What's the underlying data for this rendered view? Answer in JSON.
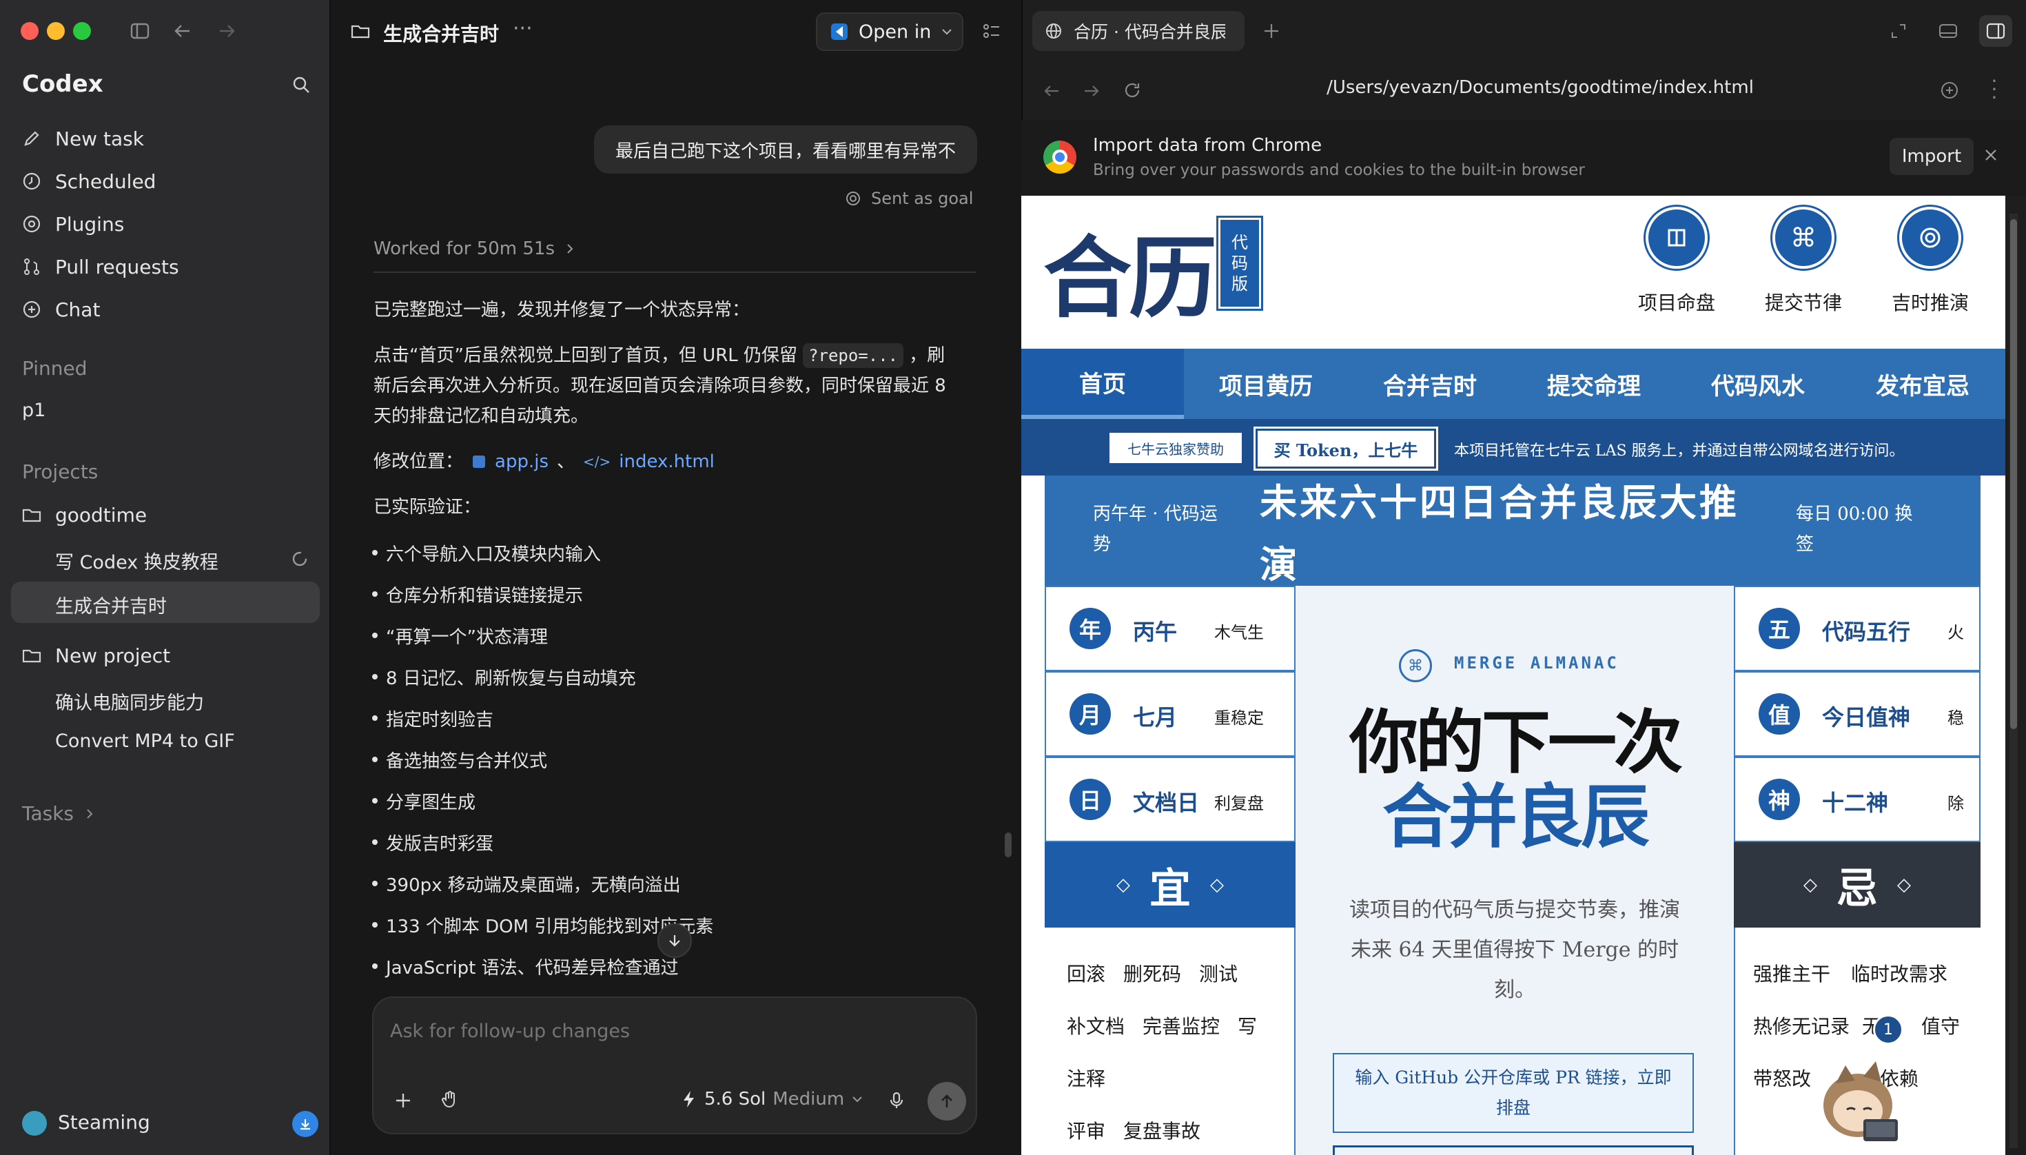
{
  "sidebar": {
    "app_name": "Codex",
    "nav": [
      {
        "label": "New task",
        "icon": "edit-icon"
      },
      {
        "label": "Scheduled",
        "icon": "clock-icon"
      },
      {
        "label": "Plugins",
        "icon": "plugin-icon"
      },
      {
        "label": "Pull requests",
        "icon": "pull-request-icon"
      },
      {
        "label": "Chat",
        "icon": "chat-plus-icon"
      }
    ],
    "pinned_header": "Pinned",
    "pinned_item": "p1",
    "projects_header": "Projects",
    "projects": [
      {
        "name": "goodtime",
        "tasks": [
          "写 Codex 换皮教程",
          "生成合并吉时"
        ]
      },
      {
        "name": "New project",
        "tasks": [
          "确认电脑同步能力",
          "Convert MP4 to GIF"
        ]
      }
    ],
    "tasks_header": "Tasks",
    "user_name": "Steaming"
  },
  "chat": {
    "title": "生成合并吉时",
    "open_in_label": "Open in",
    "user_message": "最后自己跑下这个项目，看看哪里有异常不",
    "sent_as_goal": "Sent as goal",
    "worked_for": "Worked for 50m 51s",
    "para1": "已完整跑过一遍，发现并修复了一个状态异常：",
    "para2_a": "点击“首页”后虽然视觉上回到了首页，但 URL 仍保留",
    "para2_code": "?repo=...",
    "para2_b": "，刷",
    "para2_line2": "新后会再次进入分析页。现在返回首页会清除项目参数，同时保留最近 8",
    "para2_line3": "天的排盘记忆和自动填充。",
    "modify_label": "修改位置：",
    "file1": "app.js",
    "sep": "、",
    "file2": "index.html",
    "verified_label": "已实际验证：",
    "bullets": [
      "六个导航入口及模块内输入",
      "仓库分析和错误链接提示",
      "“再算一个”状态清理",
      "8 日记忆、刷新恢复与自动填充",
      "指定时刻验吉",
      "备选抽签与合并仪式",
      "分享图生成",
      "发版吉时彩蛋",
      "390px 移动端及桌面端，无横向溢出",
      "133 个脚本 DOM 引用均能找到对应元素",
      "JavaScript 语法、代码差异检查通过"
    ],
    "input_placeholder": "Ask for follow-up changes",
    "model_label": "5.6 Sol",
    "model_effort": "Medium"
  },
  "browser": {
    "tab_title": "合历 · 代码合并良辰",
    "url": "/Users/yevazn/Documents/goodtime/index.html",
    "import_title": "Import data from Chrome",
    "import_sub": "Bring over your passwords and cookies to the built-in browser",
    "import_button": "Import"
  },
  "site": {
    "logo": "合历",
    "logo_badge": [
      "代",
      "码",
      "版"
    ],
    "top_icons": [
      {
        "label": "项目命盘",
        "icon": "square-icon"
      },
      {
        "label": "提交节律",
        "icon": "command-icon"
      },
      {
        "label": "吉时推演",
        "icon": "target-icon"
      }
    ],
    "nav": [
      "首页",
      "项目黄历",
      "合并吉时",
      "提交命理",
      "代码风水",
      "发布宜忌"
    ],
    "sponsor_tag": "七牛云独家赞助",
    "sponsor_button": "买 Token，上七牛",
    "sponsor_text": "本项目托管在七牛云 LAS 服务上，并通过自带公网域名进行访问。",
    "banner_left": [
      "丙午年 · 代码运",
      "势"
    ],
    "banner_title": [
      "未来六十四日合并良辰大推",
      "演"
    ],
    "banner_right": [
      "每日 00:00 换",
      "签"
    ],
    "left_cells": [
      {
        "badge": "年",
        "name": "丙午",
        "desc": "木气生"
      },
      {
        "badge": "月",
        "name": "七月",
        "desc": "重稳定"
      },
      {
        "badge": "日",
        "name": "文档日",
        "desc": "利复盘"
      }
    ],
    "right_cells": [
      {
        "badge": "五",
        "name": "代码五行",
        "desc": "火"
      },
      {
        "badge": "值",
        "name": "今日值神",
        "desc": "稳"
      },
      {
        "badge": "神",
        "name": "十二神",
        "desc": "除"
      }
    ],
    "yi_label": "宜",
    "ji_label": "忌",
    "yi_items": [
      [
        "回滚",
        "删死码",
        "测试"
      ],
      [
        "补文档",
        "完善监控",
        "写"
      ],
      [
        "注释"
      ],
      [
        "评审",
        "复盘事故"
      ]
    ],
    "ji_items": [
      [
        "强推主干",
        "临时改需求"
      ],
      [
        "热修无记录",
        "无",
        "值守"
      ],
      [
        "带怒改",
        "依赖"
      ]
    ],
    "merge_almanac": "MERGE ALMANAC",
    "hero_line1": "你的下一次",
    "hero_line2": "合并良辰",
    "desc": [
      "读项目的代码气质与提交节奏，推演",
      "未来 64 天里值得按下 Merge 的时",
      "刻。"
    ],
    "input_hint": [
      "输入 GitHub 公开仓库或 PR 链接，立即",
      "排盘"
    ],
    "notif_count": "1"
  },
  "colors": {
    "accent": "#2f6fb3",
    "navy": "#1d4f8f",
    "dark": "#30363f"
  }
}
